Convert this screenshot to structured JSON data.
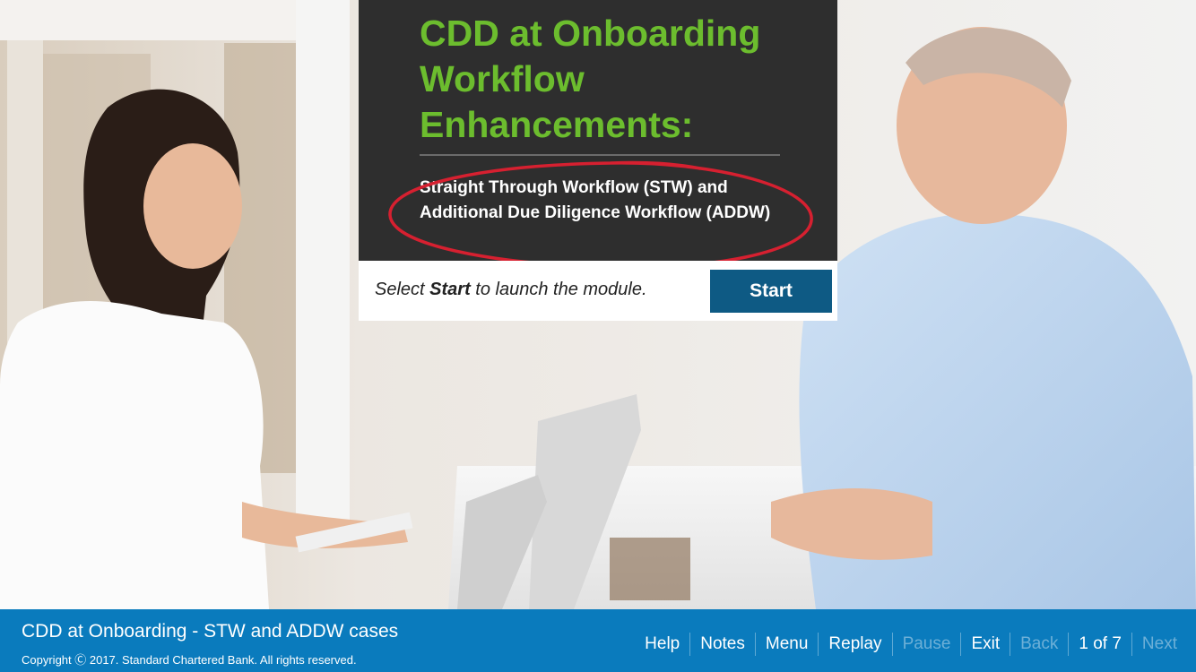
{
  "slide": {
    "title": "CDD at Onboarding Workflow Enhancements:",
    "subtitle": "Straight Through Workflow (STW) and Additional Due Diligence Workflow (ADDW)",
    "start_prompt_pre": "Select ",
    "start_prompt_bold": "Start",
    "start_prompt_post": " to launch the module.",
    "start_label": "Start",
    "annotation_color": "#d62030"
  },
  "footer": {
    "course_title": "CDD at Onboarding - STW and ADDW cases",
    "copyright": "Copyright Ⓒ 2017. Standard Chartered Bank. All rights reserved.",
    "nav": {
      "help": "Help",
      "notes": "Notes",
      "menu": "Menu",
      "replay": "Replay",
      "pause": "Pause",
      "exit": "Exit",
      "back": "Back",
      "page_indicator": "1 of 7",
      "next": "Next"
    }
  },
  "colors": {
    "footer_bg": "#0a7bbd",
    "title_green": "#6cbd2e",
    "card_bg": "#2e2e2e",
    "start_button_bg": "#0e5a84"
  }
}
